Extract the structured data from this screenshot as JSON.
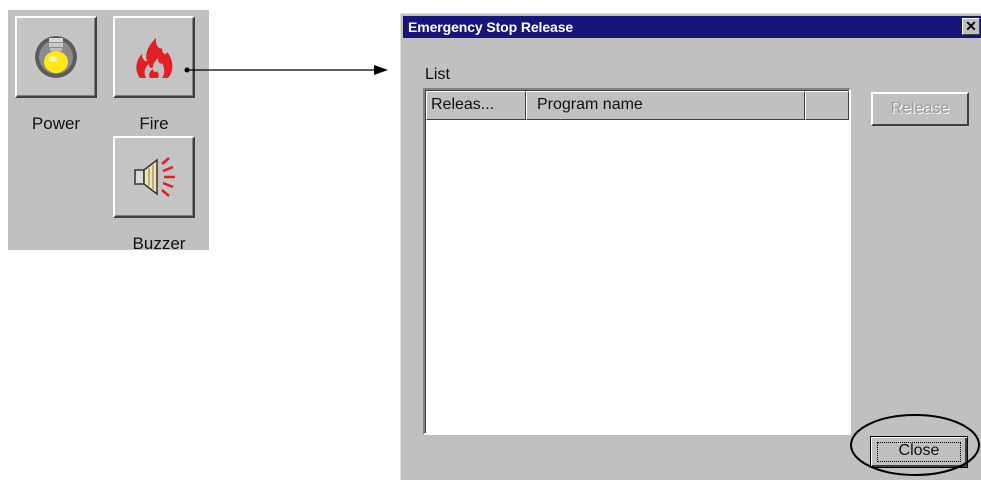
{
  "panel": {
    "buttons": [
      {
        "label": "Power",
        "icon": "light-bulb-icon"
      },
      {
        "label": "Fire",
        "icon": "flame-icon"
      },
      {
        "label": "Buzzer",
        "icon": "speaker-icon"
      }
    ]
  },
  "dialog": {
    "title": "Emergency Stop Release",
    "close_glyph": "✕",
    "list_caption": "List",
    "columns": [
      "Releas...",
      "Program name",
      ""
    ],
    "rows": [],
    "release_label": "Release",
    "close_label": "Close"
  },
  "colors": {
    "title_bar": "#16167a",
    "dialog_bg": "#c0c0c0",
    "fire_red": "#e31e24",
    "bulb_yellow": "#ffe81a"
  }
}
